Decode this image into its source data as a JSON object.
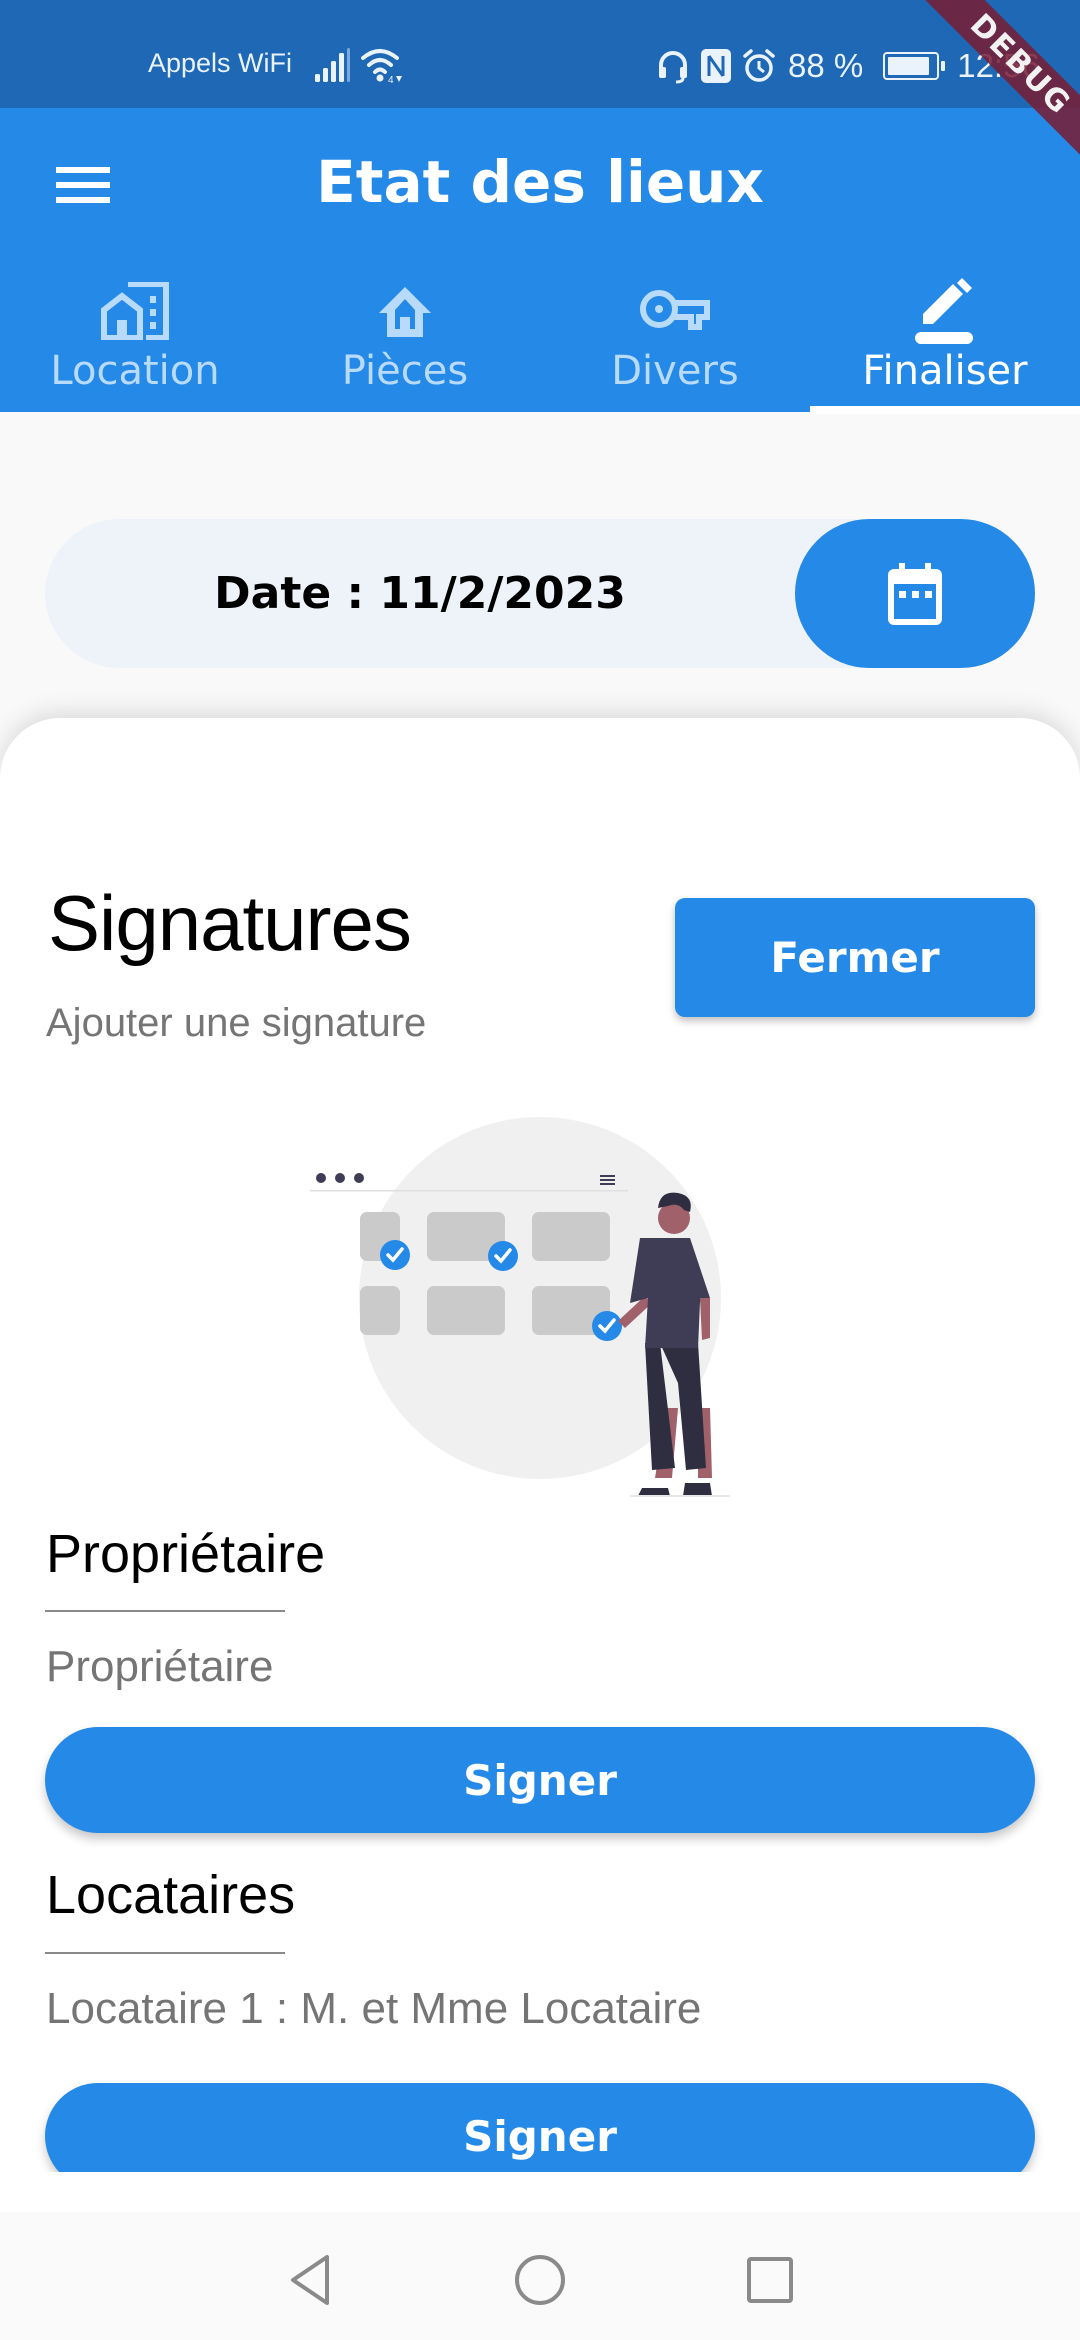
{
  "status_bar": {
    "carrier": "Appels WiFi",
    "battery_percent": "88 %",
    "battery_level": 0.88,
    "time": "12:56",
    "icons": [
      "signal-icon",
      "wifi-icon",
      "headset-icon",
      "nfc-icon",
      "alarm-icon",
      "battery-icon"
    ]
  },
  "debug_banner": "DEBUG",
  "app_bar": {
    "title": "Etat des lieux",
    "menu_icon": "hamburger-menu-icon"
  },
  "tabs": [
    {
      "label": "Location",
      "icon": "building-house-icon",
      "active": false
    },
    {
      "label": "Pièces",
      "icon": "home-icon",
      "active": false
    },
    {
      "label": "Divers",
      "icon": "key-icon",
      "active": false
    },
    {
      "label": "Finaliser",
      "icon": "edit-pen-icon",
      "active": true
    }
  ],
  "date_row": {
    "label": "Date : 11/2/2023",
    "calendar_icon": "calendar-icon"
  },
  "signatures": {
    "title": "Signatures",
    "subtitle": "Ajouter une signature",
    "close_label": "Fermer"
  },
  "owner_section": {
    "heading": "Propriétaire",
    "name": "Propriétaire",
    "sign_label": "Signer"
  },
  "tenants_section": {
    "heading": "Locataires",
    "tenants": [
      {
        "label": "Locataire 1 : M. et Mme Locataire",
        "sign_label": "Signer"
      }
    ]
  },
  "nav_bar": {
    "buttons": [
      "back-icon",
      "home-circle-icon",
      "recents-square-icon"
    ]
  },
  "colors": {
    "primary": "#2589E8",
    "status_bar": "#1E68B5",
    "date_pill": "#EEF3FA",
    "muted_text": "#757575",
    "debug_ribbon": "#781C32"
  }
}
